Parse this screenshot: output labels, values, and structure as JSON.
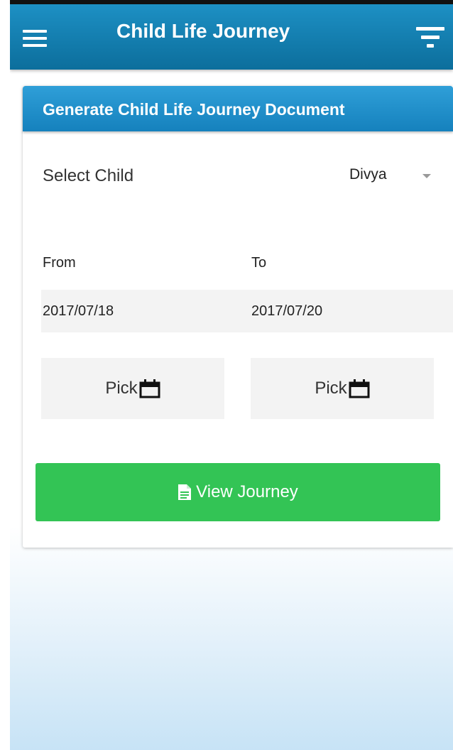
{
  "appbar": {
    "title": "Child Life Journey",
    "menu_icon": "hamburger-menu-icon",
    "filter_icon": "filter-icon",
    "color": "#0f78a8"
  },
  "card": {
    "header_title": "Generate Child Life Journey Document",
    "header_color": "#2594cf",
    "select_child": {
      "label": "Select Child",
      "value": "Divya"
    },
    "from": {
      "label": "From",
      "value": "2017/07/18",
      "pick_label": "Pick"
    },
    "to": {
      "label": "To",
      "value": "2017/07/20",
      "pick_label": "Pick"
    },
    "view_button": {
      "label": "View Journey",
      "icon": "document-icon",
      "color": "#33c455"
    }
  }
}
